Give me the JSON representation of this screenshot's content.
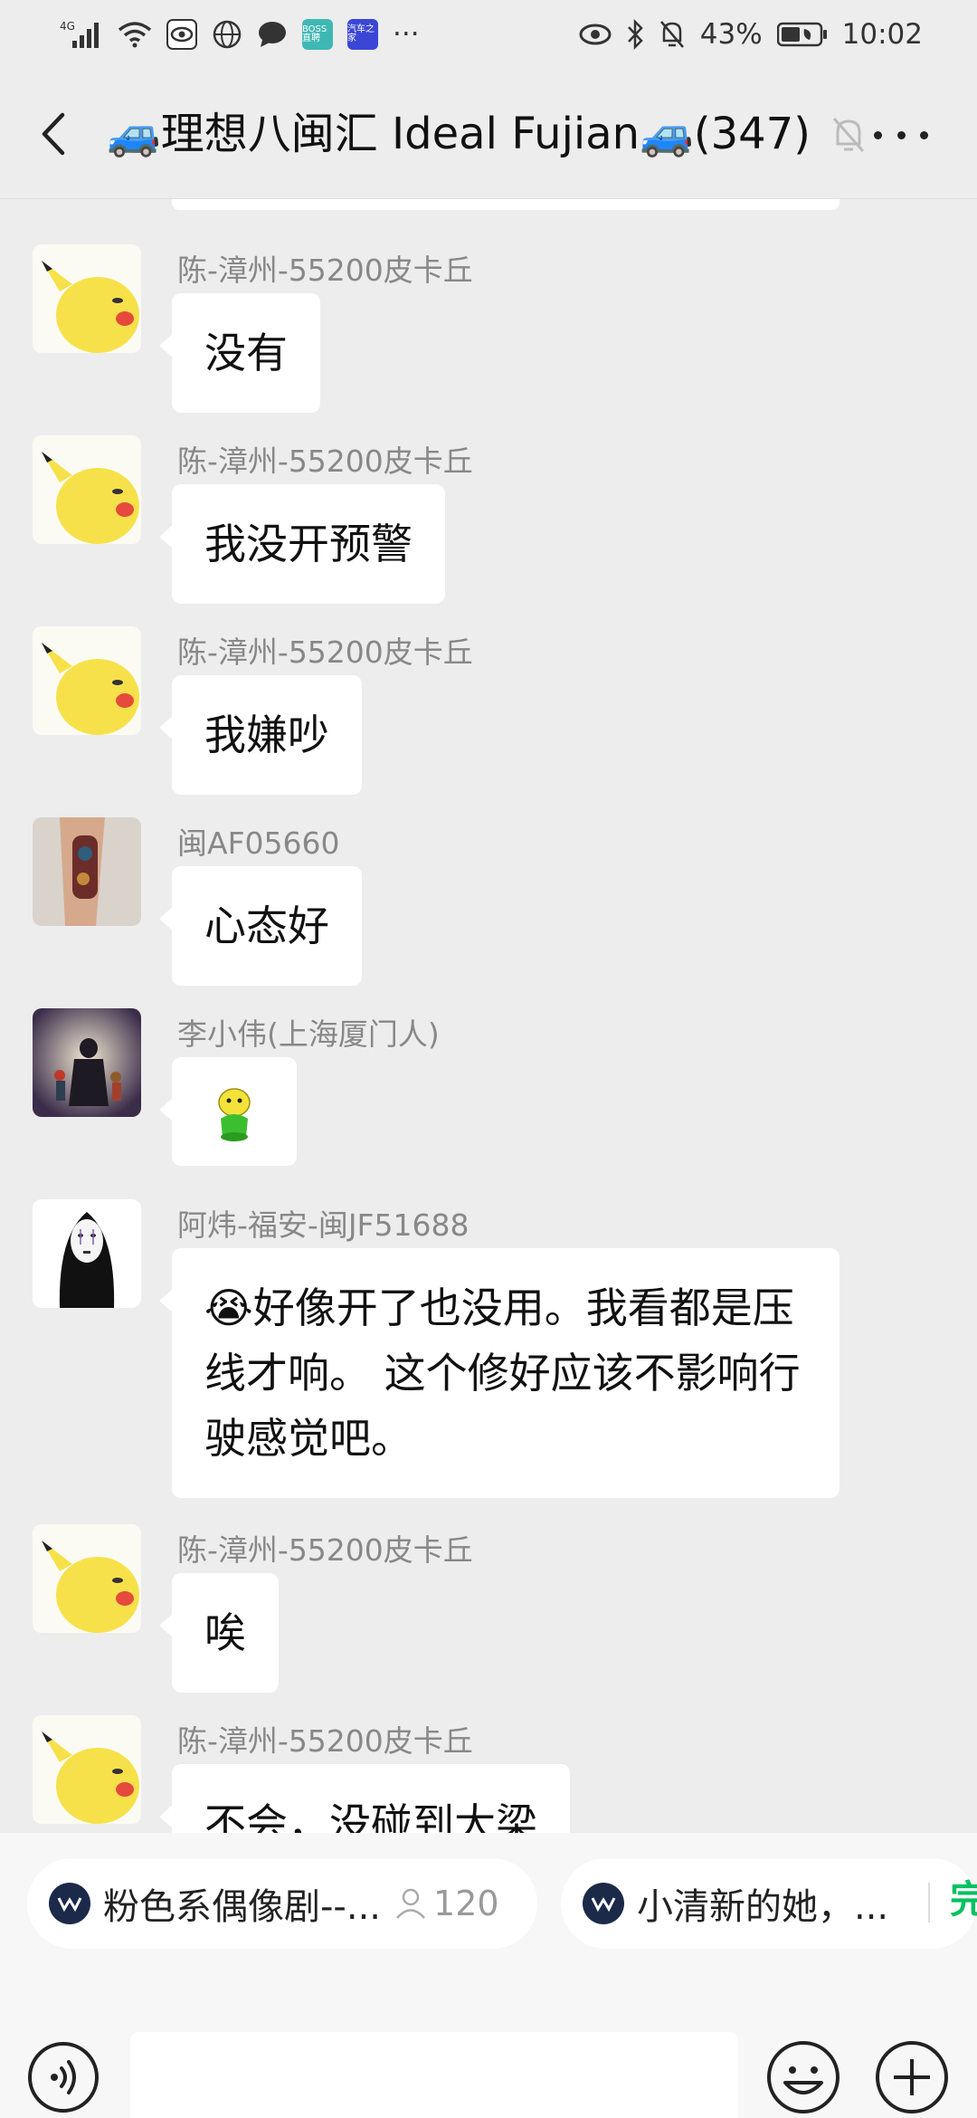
{
  "status_bar": {
    "network": "4G",
    "badge_boss": "BOSS 直聘",
    "badge_car": "汽车之家",
    "overflow": "···",
    "battery": "43%",
    "time": "10:02"
  },
  "header": {
    "title": "🚙理想八闽汇 Ideal Fujian🚙(347)"
  },
  "messages": [
    {
      "sender": "陈-漳州-55200皮卡丘",
      "text": "没有",
      "avatar": "pikachu"
    },
    {
      "sender": "陈-漳州-55200皮卡丘",
      "text": "我没开预警",
      "avatar": "pikachu"
    },
    {
      "sender": "陈-漳州-55200皮卡丘",
      "text": "我嫌吵",
      "avatar": "pikachu"
    },
    {
      "sender": "闽AF05660",
      "text": "心态好",
      "avatar": "tattoo-arm"
    },
    {
      "sender": "李小伟(上海厦门人)",
      "text": "",
      "avatar": "silhouette-family",
      "sticker": "green-figure-emoji"
    },
    {
      "sender": "阿炜-福安-闽JF51688",
      "text": "😭好像开了也没用。我看都是压线才响。  这个修好应该不影响行驶感觉吧。",
      "avatar": "no-face"
    },
    {
      "sender": "陈-漳州-55200皮卡丘",
      "text": "唉",
      "avatar": "pikachu"
    },
    {
      "sender": "陈-漳州-55200皮卡丘",
      "text": "不会，没碰到大梁",
      "avatar": "pikachu"
    }
  ],
  "live_strip": {
    "card1_title": "粉色系偶像剧--...",
    "card1_count": "120",
    "card2_title": "小清新的她，...",
    "card3_partial": "完"
  },
  "input": {
    "placeholder": ""
  },
  "colors": {
    "background": "#ededed",
    "bubble": "#ffffff",
    "accent_green": "#07c160"
  }
}
